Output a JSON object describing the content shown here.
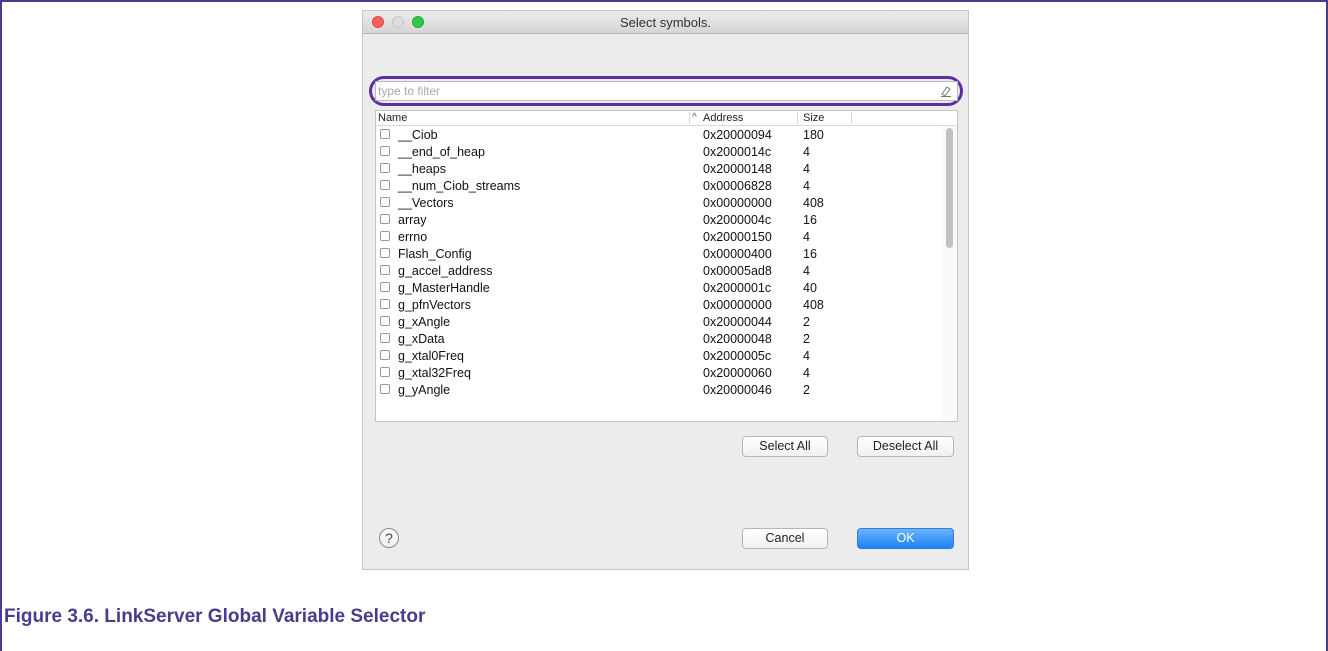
{
  "window": {
    "title": "Select symbols."
  },
  "filter": {
    "placeholder": "type to filter",
    "value": ""
  },
  "table": {
    "headers": {
      "name": "Name",
      "sort_indicator": "^",
      "address": "Address",
      "size": "Size"
    },
    "rows": [
      {
        "name": "__Ciob",
        "address": "0x20000094",
        "size": "180"
      },
      {
        "name": "__end_of_heap",
        "address": "0x2000014c",
        "size": "4"
      },
      {
        "name": "__heaps",
        "address": "0x20000148",
        "size": "4"
      },
      {
        "name": "__num_Ciob_streams",
        "address": "0x00006828",
        "size": "4"
      },
      {
        "name": "__Vectors",
        "address": "0x00000000",
        "size": "408"
      },
      {
        "name": "array",
        "address": "0x2000004c",
        "size": "16"
      },
      {
        "name": "errno",
        "address": "0x20000150",
        "size": "4"
      },
      {
        "name": "Flash_Config",
        "address": "0x00000400",
        "size": "16"
      },
      {
        "name": "g_accel_address",
        "address": "0x00005ad8",
        "size": "4"
      },
      {
        "name": "g_MasterHandle",
        "address": "0x2000001c",
        "size": "40"
      },
      {
        "name": "g_pfnVectors",
        "address": "0x00000000",
        "size": "408"
      },
      {
        "name": "g_xAngle",
        "address": "0x20000044",
        "size": "2"
      },
      {
        "name": "g_xData",
        "address": "0x20000048",
        "size": "2"
      },
      {
        "name": "g_xtal0Freq",
        "address": "0x2000005c",
        "size": "4"
      },
      {
        "name": "g_xtal32Freq",
        "address": "0x20000060",
        "size": "4"
      },
      {
        "name": "g_yAngle",
        "address": "0x20000046",
        "size": "2"
      }
    ]
  },
  "buttons": {
    "select_all": "Select All",
    "deselect_all": "Deselect All",
    "cancel": "Cancel",
    "ok": "OK",
    "help": "?"
  },
  "caption": "Figure 3.6. LinkServer Global Variable Selector",
  "colors": {
    "accent_blue": "#1b82f5",
    "highlight_purple": "#5b2ea6",
    "caption_purple": "#4b3b8c"
  }
}
